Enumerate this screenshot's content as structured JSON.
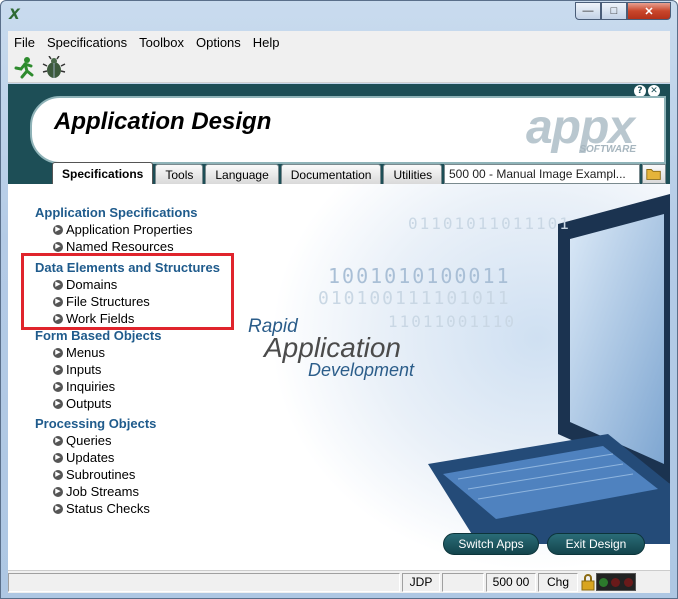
{
  "titlebar": {
    "icon": "appx-x-icon",
    "buttons": [
      "minimize",
      "maximize",
      "close"
    ]
  },
  "menu": {
    "items": [
      "File",
      "Specifications",
      "Toolbox",
      "Options",
      "Help"
    ]
  },
  "toolbar": {
    "icons": [
      "running-man-icon",
      "beetle-icon"
    ]
  },
  "banner": {
    "title": "Application Design",
    "logo": "appx",
    "logo_sub": "SOFTWARE",
    "help_buttons": [
      "?",
      "✕"
    ]
  },
  "tabs": [
    "Specifications",
    "Tools",
    "Language",
    "Documentation",
    "Utilities"
  ],
  "active_tab": "Specifications",
  "app_field": "500 00 - Manual Image Exampl...",
  "nav": {
    "sections": [
      {
        "title": "Application Specifications",
        "items": [
          "Application Properties",
          "Named Resources"
        ]
      },
      {
        "title": "Data Elements and Structures",
        "items": [
          "Domains",
          "File Structures",
          "Work Fields"
        ]
      },
      {
        "title": "Form Based Objects",
        "items": [
          "Menus",
          "Inputs",
          "Inquiries",
          "Outputs"
        ]
      },
      {
        "title": "Processing Objects",
        "items": [
          "Queries",
          "Updates",
          "Subroutines",
          "Job Streams",
          "Status Checks"
        ]
      }
    ]
  },
  "decor": {
    "binary_lines": [
      "01101011011101",
      "1001010100011",
      "010100111101011",
      "11011001110"
    ],
    "rapid": "Rapid",
    "application": "Application",
    "development": "Development"
  },
  "buttons": {
    "switch_apps": "Switch Apps",
    "exit_design": "Exit Design"
  },
  "status": {
    "user": "JDP",
    "blank": "",
    "app_id": "500 00",
    "mode": "Chg"
  },
  "colors": {
    "banner": "#1d4e56",
    "section_title": "#1f5b8c",
    "highlight_box": "#e0242c"
  }
}
